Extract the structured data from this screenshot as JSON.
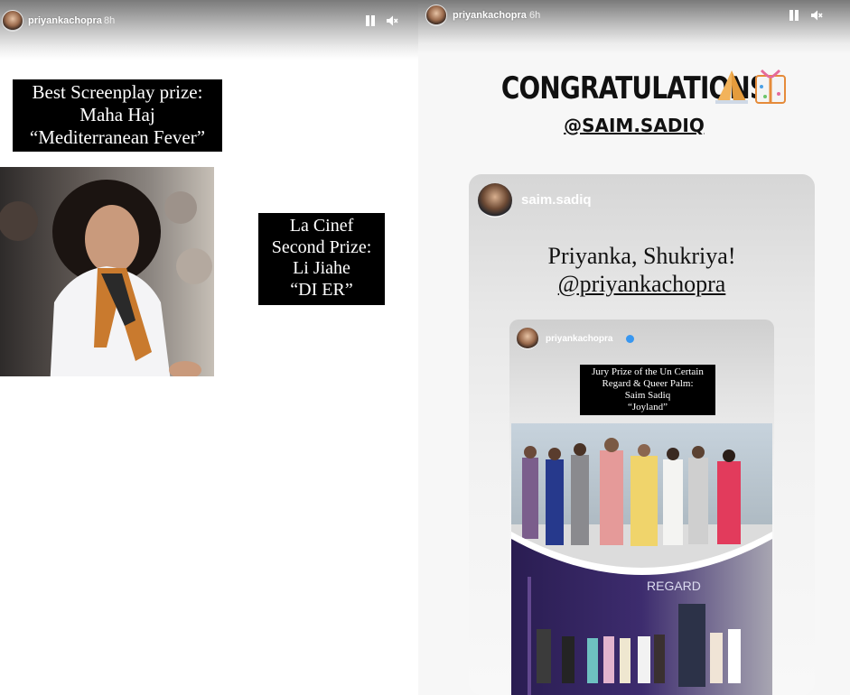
{
  "left_story": {
    "username": "priyankachopra",
    "timestamp": "8h",
    "awards": [
      {
        "lines": [
          "Best Screenplay prize:",
          "Maha Haj",
          "“Mediterranean Fever”"
        ]
      },
      {
        "lines": [
          "La Cinef",
          "Second Prize:",
          "Li Jiahe",
          "“DI ER”"
        ]
      }
    ]
  },
  "right_story": {
    "username": "priyankachopra",
    "timestamp": "6h",
    "title": "CONGRATULATIONS",
    "mention": "@SAIM.SADIQ",
    "shared_post": {
      "username": "saim.sadiq",
      "message_line1": "Priyanka, Shukriya!",
      "message_line2": "@priyankachopra",
      "nested_post": {
        "username": "priyankachopra",
        "award_lines": [
          "Jury Prize of the Un Certain",
          "Regard & Queer Palm:",
          "Saim Sadiq",
          "“Joyland”"
        ],
        "photo_sign_text": "REGARD"
      }
    }
  },
  "icons": {
    "pause": "pause-icon",
    "mute": "speaker-muted-icon",
    "verified": "verified-badge-icon",
    "folded_hands": "folded-hands-emoji",
    "gift": "wrapped-gift-emoji"
  },
  "colors": {
    "caption_bg": "#000000",
    "caption_text": "#ffffff",
    "verified": "#3897f0"
  }
}
